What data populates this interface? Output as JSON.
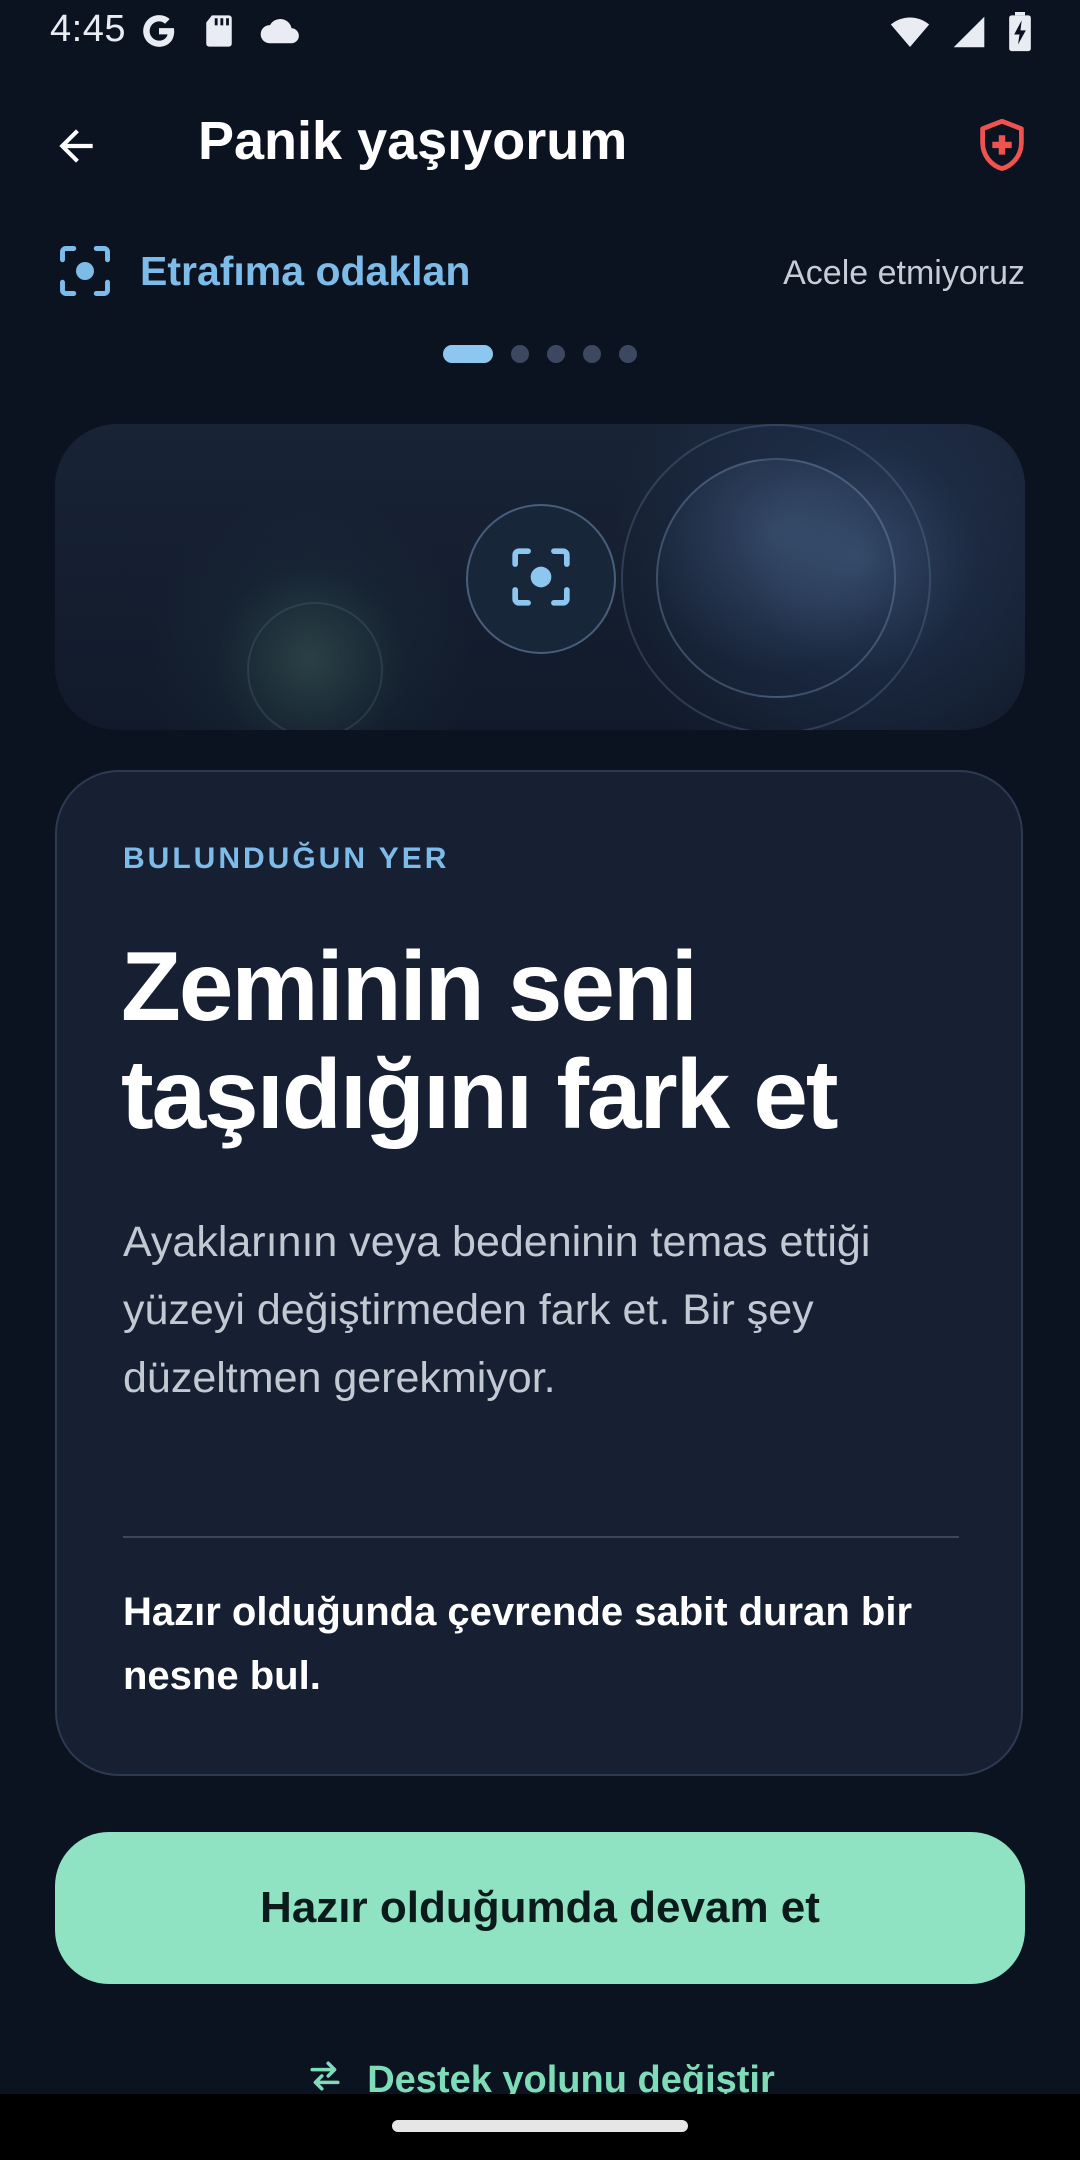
{
  "status_bar": {
    "time": "4:45",
    "left_icons": [
      "google-icon",
      "sd-card-icon",
      "cloud-icon"
    ],
    "right_icons": [
      "wifi-icon",
      "signal-icon",
      "battery-charging-icon"
    ]
  },
  "app_bar": {
    "title": "Panik yaşıyorum",
    "back_icon": "arrow-left-icon",
    "action_icon": "shield-medical-icon",
    "action_color": "#ef5350"
  },
  "step": {
    "icon": "focus-center-icon",
    "title": "Etrafıma odaklan",
    "hint": "Acele etmiyoruz"
  },
  "pager": {
    "total": 5,
    "active_index": 0
  },
  "hero": {
    "center_icon": "focus-center-icon"
  },
  "card": {
    "eyebrow": "BULUNDUĞUN YER",
    "heading": "Zeminin seni taşıdığını fark et",
    "body": "Ayaklarının veya bedeninin temas ettiği yüzeyi değiştirmeden fark et. Bir şey düzeltmen gerekmiyor.",
    "note": "Hazır olduğunda çevrende sabit duran bir nesne bul."
  },
  "primary_button": {
    "label": "Hazır olduğumda devam et",
    "color": "#8fe3c3"
  },
  "secondary_link": {
    "icon": "swap-arrows-icon",
    "label": "Destek yolunu değiştir"
  },
  "theme": {
    "background": "#0b1220",
    "accent_blue": "#7dbbe8",
    "accent_green": "#8fe3c3"
  }
}
